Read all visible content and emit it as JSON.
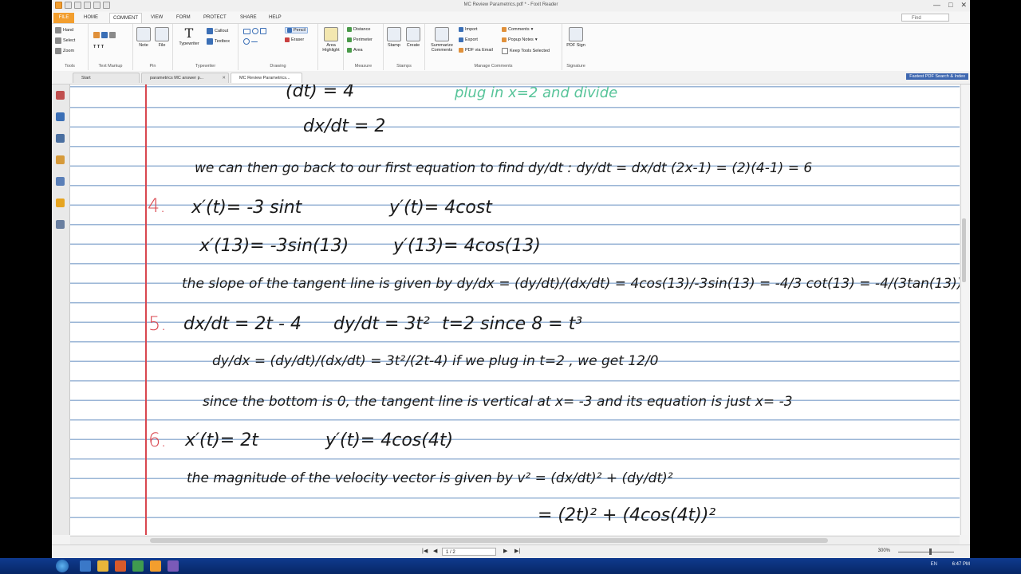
{
  "window": {
    "title": "MC Review Parametrics.pdf * - Foxit Reader",
    "controls": [
      "—",
      "□",
      "✕"
    ]
  },
  "ribbon_tabs": [
    {
      "label": "FILE"
    },
    {
      "label": "HOME"
    },
    {
      "label": "COMMENT"
    },
    {
      "label": "VIEW"
    },
    {
      "label": "FORM"
    },
    {
      "label": "PROTECT"
    },
    {
      "label": "SHARE"
    },
    {
      "label": "HELP"
    }
  ],
  "search": {
    "placeholder": "Find"
  },
  "ribbon": {
    "tools": {
      "label": "Tools",
      "items": [
        "Hand",
        "Select",
        "Zoom"
      ]
    },
    "text_markup": {
      "label": "Text Markup"
    },
    "pin": {
      "label": "Pin",
      "note": "Note",
      "file": "File"
    },
    "typewriter": {
      "label": "Typewriter",
      "typewriter": "Typewriter",
      "callout": "Callout",
      "textbox": "Textbox"
    },
    "drawing": {
      "label": "Drawing",
      "pencil": "Pencil",
      "eraser": "Eraser"
    },
    "area_highlight": {
      "label": "Area Highlight"
    },
    "measure": {
      "label": "Measure",
      "items": [
        "Distance",
        "Perimeter",
        "Area"
      ]
    },
    "stamps": {
      "label": "Stamps",
      "stamp": "Stamp",
      "create": "Create"
    },
    "manage_comments": {
      "label": "Manage Comments",
      "summarize": "Summarize Comments",
      "import": "Import",
      "export": "Export",
      "pdf_email": "PDF via Email",
      "comments": "Comments",
      "popup_notes": "Popup Notes",
      "keep_tools": "Keep Tools Selected"
    },
    "signature": {
      "label": "Signature",
      "pdf_sign": "PDF Sign"
    }
  },
  "doc_tabs": [
    {
      "label": "Start"
    },
    {
      "label": "parametrics MC answer p..."
    },
    {
      "label": "MC Review Parametrics..."
    }
  ],
  "banner": "Fastest PDF Search & Index",
  "notes": {
    "line_top_a": "(dt) = 4",
    "line_top_hint": "plug in  x=2  and divide",
    "line_dxdt": "dx/dt = 2",
    "line_find": "we can then go back to our first equation to find dy/dt : dy/dt = dx/dt (2x-1) = (2)(4-1) = 6",
    "p4_num": "4.",
    "p4_a": "x′(t)= -3 sint",
    "p4_b": "y′(t)= 4cost",
    "p4_c": "x′(13)= -3sin(13)",
    "p4_d": "y′(13)= 4cos(13)",
    "p4_e": "the slope of the tangent line is given by  dy/dx = (dy/dt)/(dx/dt) = 4cos(13)/-3sin(13) = -4/3 cot(13) = -4/(3tan(13))",
    "p5_num": "5.",
    "p5_a": "dx/dt = 2t - 4",
    "p5_b": "dy/dt = 3t²",
    "p5_c": "t=2  since  8 = t³",
    "p5_d": "dy/dx = (dy/dt)/(dx/dt) = 3t²/(2t-4)   if we plug in  t=2 , we get  12/0",
    "p5_e": "since the bottom is 0, the tangent line is vertical at  x= -3  and its equation is just  x= -3",
    "p6_num": "6.",
    "p6_a": "x′(t)= 2t",
    "p6_b": "y′(t)= 4cos(4t)",
    "p6_c": "the magnitude of the velocity vector is given by  v² = (dx/dt)² + (dy/dt)²",
    "p6_d": "= (2t)² + (4cos(4t))²"
  },
  "status": {
    "page": "1 / 2",
    "zoom": "300%",
    "nav": [
      "|◀",
      "◀",
      "▶",
      "▶|"
    ]
  },
  "taskbar": {
    "clock": "6:47 PM",
    "lang": "EN"
  },
  "colors": {
    "accent_file": "#f29e2e",
    "margin_red": "#d9474f",
    "rule_blue": "#9ab5d6",
    "hint_green": "#58c49a"
  }
}
